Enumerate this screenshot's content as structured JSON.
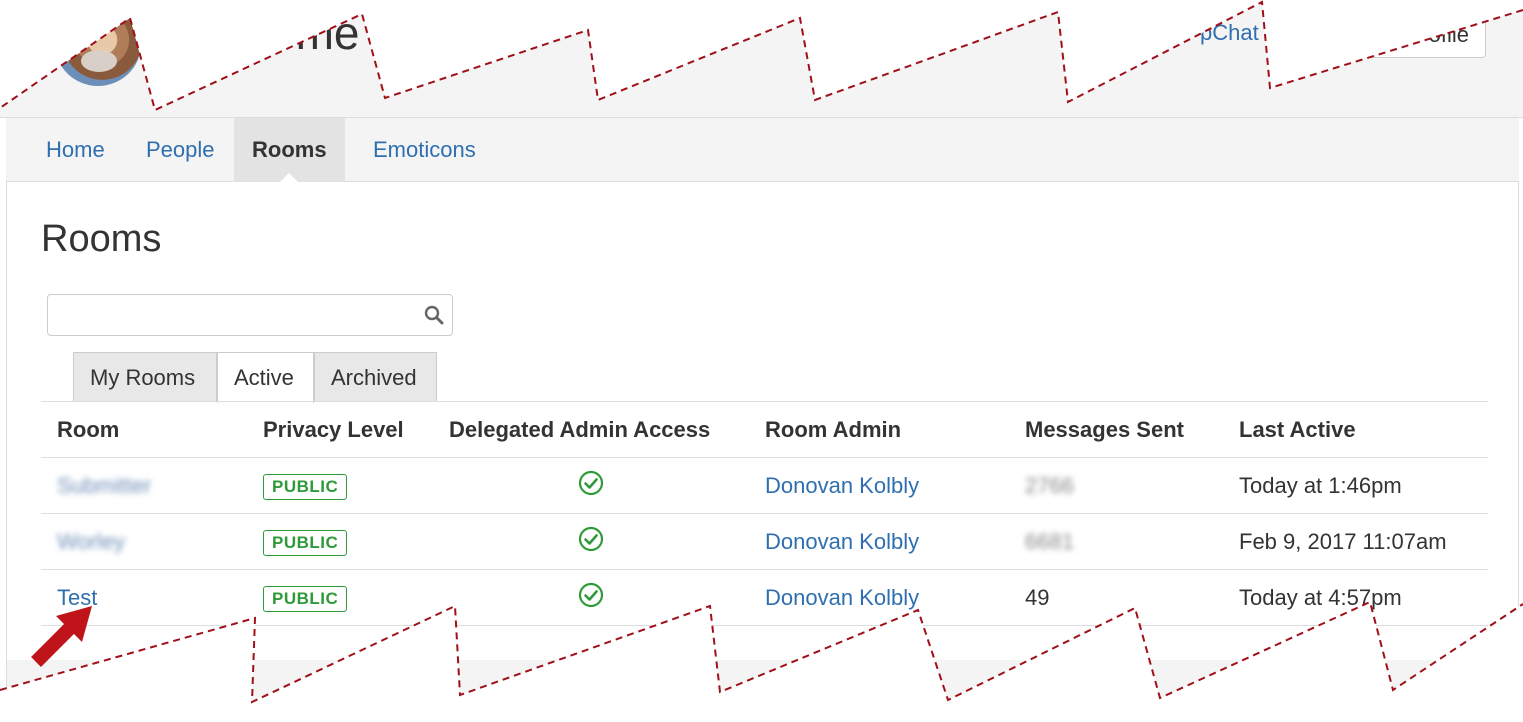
{
  "header": {
    "title": "ome    ova",
    "brand_link": "pChat",
    "profile_button": "ofile"
  },
  "nav": {
    "items": [
      {
        "label": "Home"
      },
      {
        "label": "People"
      },
      {
        "label": "Rooms",
        "active": true
      },
      {
        "label": "Emoticons"
      }
    ]
  },
  "main": {
    "title": "Rooms",
    "search": {
      "placeholder": "",
      "value": ""
    },
    "tabs": [
      {
        "label": "My Rooms"
      },
      {
        "label": "Active",
        "active": true
      },
      {
        "label": "Archived"
      }
    ],
    "table": {
      "headers": [
        "Room",
        "Privacy Level",
        "Delegated Admin Access",
        "Room Admin",
        "Messages Sent",
        "Last Active"
      ],
      "rows": [
        {
          "room": "Submitter",
          "privacy": "PUBLIC",
          "delegated": "check-circle-icon",
          "admin": "Donovan Kolbly",
          "messages": "2766",
          "last_active": "Today at 1:46pm"
        },
        {
          "room": "Worley",
          "privacy": "PUBLIC",
          "delegated": "check-circle-icon",
          "admin": "Donovan Kolbly",
          "messages": "6681",
          "last_active": "Feb 9, 2017 11:07am"
        },
        {
          "room": "Test",
          "privacy": "PUBLIC",
          "delegated": "check-circle-icon",
          "admin": "Donovan Kolbly",
          "messages": "49",
          "last_active": "Today at 4:57pm"
        }
      ]
    }
  },
  "colors": {
    "link": "#2f6fb0",
    "public_badge": "#2e9a3a",
    "annotation_arrow": "#c0141b",
    "torn_edge": "#a01018"
  }
}
